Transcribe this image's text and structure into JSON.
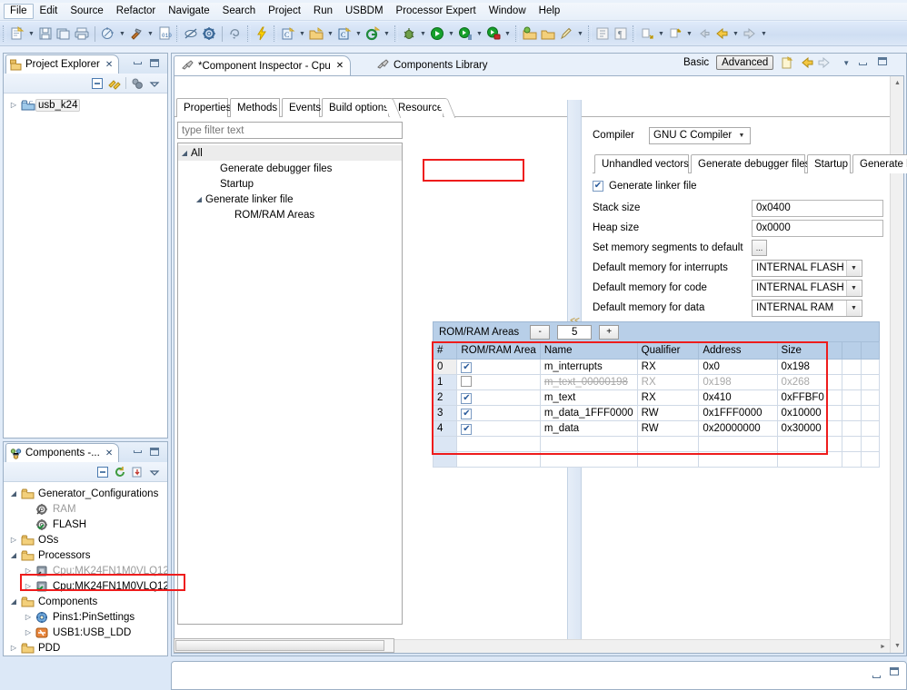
{
  "menu": {
    "items": [
      {
        "label": "File",
        "active": true
      },
      {
        "label": "Edit",
        "active": false
      },
      {
        "label": "Source",
        "active": false
      },
      {
        "label": "Refactor",
        "active": false
      },
      {
        "label": "Navigate",
        "active": false
      },
      {
        "label": "Search",
        "active": false
      },
      {
        "label": "Project",
        "active": false
      },
      {
        "label": "Run",
        "active": false
      },
      {
        "label": "USBDM",
        "active": false
      },
      {
        "label": "Processor Expert",
        "active": false
      },
      {
        "label": "Window",
        "active": false
      },
      {
        "label": "Help",
        "active": false
      }
    ]
  },
  "perspective": {
    "basic_label": "Basic",
    "advanced_label": "Advanced",
    "new_icon": "new-file-icon",
    "back_icon": "back-arrow-icon",
    "forward_icon": "forward-arrow-icon",
    "menu_icon": "view-menu-icon",
    "minimize_icon": "minimize-icon",
    "maximize_icon": "maximize-icon"
  },
  "project_explorer": {
    "tab_label": "Project Explorer",
    "tab_icon": "project-explorer-icon",
    "close_icon": "close-icon",
    "minimize_icon": "minimize-icon",
    "maximize_icon": "maximize-icon",
    "toolbar_icons": [
      "collapse-all-icon",
      "link-with-editor-icon",
      "filter-icon",
      "view-menu-icon"
    ],
    "tree": [
      {
        "label": "usb_k24",
        "icon": "c-project-folder-icon",
        "indent": 0,
        "twisty": "collapsed",
        "selected": true
      }
    ]
  },
  "components_view": {
    "tab_label": "Components -...",
    "tab_icon": "components-view-icon",
    "close_icon": "close-icon",
    "minimize_icon": "minimize-icon",
    "maximize_icon": "maximize-icon",
    "toolbar_icons": [
      "collapse-all-icon",
      "refresh-icon",
      "import-component-icon",
      "view-menu-icon"
    ],
    "tree": [
      {
        "label": "Generator_Configurations",
        "icon": "folder-icon",
        "indent": 0,
        "twisty": "expanded",
        "dim": false
      },
      {
        "label": "RAM",
        "icon": "gear-disabled-icon",
        "indent": 1,
        "twisty": "none",
        "dim": true
      },
      {
        "label": "FLASH",
        "icon": "gear-enabled-icon",
        "indent": 1,
        "twisty": "none",
        "dim": false
      },
      {
        "label": "OSs",
        "icon": "folder-icon",
        "indent": 0,
        "twisty": "collapsed",
        "dim": false
      },
      {
        "label": "Processors",
        "icon": "folder-icon",
        "indent": 0,
        "twisty": "expanded",
        "dim": false
      },
      {
        "label": "Cpu:MK24FN1M0VLQ12",
        "icon": "cpu-disabled-icon",
        "indent": 1,
        "twisty": "collapsed",
        "dim": true
      },
      {
        "label": "Cpu:MK24FN1M0VLQ12",
        "icon": "cpu-enabled-icon",
        "indent": 1,
        "twisty": "collapsed",
        "dim": false,
        "highlighted": true
      },
      {
        "label": "Components",
        "icon": "folder-icon",
        "indent": 0,
        "twisty": "expanded",
        "dim": false
      },
      {
        "label": "Pins1:PinSettings",
        "icon": "pins-component-icon",
        "indent": 1,
        "twisty": "collapsed",
        "dim": false
      },
      {
        "label": "USB1:USB_LDD",
        "icon": "usb-component-icon",
        "indent": 1,
        "twisty": "collapsed",
        "dim": false
      },
      {
        "label": "PDD",
        "icon": "folder-icon",
        "indent": 0,
        "twisty": "collapsed",
        "dim": false
      }
    ]
  },
  "editor": {
    "tabs": [
      {
        "label": "*Component Inspector - Cpu",
        "icon": "component-inspector-icon",
        "active": true,
        "close_icon": "close-icon"
      },
      {
        "label": "Components Library",
        "icon": "components-library-icon",
        "active": false
      }
    ]
  },
  "inspector": {
    "tabs": [
      {
        "label": "Properties",
        "active": false
      },
      {
        "label": "Methods",
        "active": false
      },
      {
        "label": "Events",
        "active": false
      },
      {
        "label": "Build options",
        "active": true
      },
      {
        "label": "Resources",
        "active": false
      }
    ],
    "filter_placeholder": "type filter text",
    "filter_value": "",
    "outline": [
      {
        "label": "All",
        "indent": 0,
        "twisty": "expanded",
        "header": true
      },
      {
        "label": "Generate debugger files",
        "indent": 2,
        "twisty": "none",
        "header": false
      },
      {
        "label": "Startup",
        "indent": 2,
        "twisty": "none",
        "header": false
      },
      {
        "label": "Generate linker file",
        "indent": 1,
        "twisty": "expanded",
        "header": false
      },
      {
        "label": "ROM/RAM Areas",
        "indent": 3,
        "twisty": "none",
        "header": false
      }
    ],
    "collapse_label": "<<"
  },
  "build_options": {
    "compiler_label": "Compiler",
    "compiler_value": "GNU C Compiler",
    "subtabs": [
      {
        "label": "Unhandled vectors",
        "active": false
      },
      {
        "label": "Generate debugger files",
        "active": false
      },
      {
        "label": "Startup",
        "active": false
      },
      {
        "label": "Generate linker file",
        "active": true,
        "highlighted": true
      }
    ],
    "generate_linker_file": {
      "label": "Generate linker file",
      "checked": true
    },
    "fields": [
      {
        "label": "Stack size",
        "type": "text",
        "value": "0x0400"
      },
      {
        "label": "Heap size",
        "type": "text",
        "value": "0x0000"
      },
      {
        "label": "Set memory segments to default",
        "type": "button",
        "value": "..."
      },
      {
        "label": "Default memory for interrupts",
        "type": "combo",
        "value": "INTERNAL FLASH"
      },
      {
        "label": "Default memory for code",
        "type": "combo",
        "value": "INTERNAL FLASH"
      },
      {
        "label": "Default memory for data",
        "type": "combo",
        "value": "INTERNAL RAM"
      }
    ]
  },
  "romram": {
    "title": "ROM/RAM Areas",
    "minus_label": "-",
    "plus_label": "+",
    "count": "5",
    "columns": [
      "#",
      "ROM/RAM Area",
      "Name",
      "Qualifier",
      "Address",
      "Size",
      "",
      ""
    ],
    "rows": [
      {
        "index": "0",
        "enabled": true,
        "name": "m_interrupts",
        "qualifier": "RX",
        "address": "0x0",
        "size": "0x198",
        "disabled_style": false,
        "first": true
      },
      {
        "index": "1",
        "enabled": false,
        "name": "m_text_00000198",
        "qualifier": "RX",
        "address": "0x198",
        "size": "0x268",
        "disabled_style": true,
        "first": false
      },
      {
        "index": "2",
        "enabled": true,
        "name": "m_text",
        "qualifier": "RX",
        "address": "0x410",
        "size": "0xFFBF0",
        "disabled_style": false,
        "first": false
      },
      {
        "index": "3",
        "enabled": true,
        "name": "m_data_1FFF0000",
        "qualifier": "RW",
        "address": "0x1FFF0000",
        "size": "0x10000",
        "disabled_style": false,
        "first": false
      },
      {
        "index": "4",
        "enabled": true,
        "name": "m_data",
        "qualifier": "RW",
        "address": "0x20000000",
        "size": "0x30000",
        "disabled_style": false,
        "first": false
      },
      {
        "index": "",
        "enabled": null,
        "name": "",
        "qualifier": "",
        "address": "",
        "size": "",
        "disabled_style": false,
        "first": false
      },
      {
        "index": "",
        "enabled": null,
        "name": "",
        "qualifier": "",
        "address": "",
        "size": "",
        "disabled_style": false,
        "first": false
      }
    ]
  },
  "bottom_view": {
    "minimize_icon": "minimize-icon",
    "maximize_icon": "maximize-icon"
  },
  "colors": {
    "highlight_red": "#ee1c1c",
    "table_header_blue": "#b8cfe8",
    "selection_blue": "#dbe6f4",
    "toolbar_blue": "#cfdef2"
  }
}
